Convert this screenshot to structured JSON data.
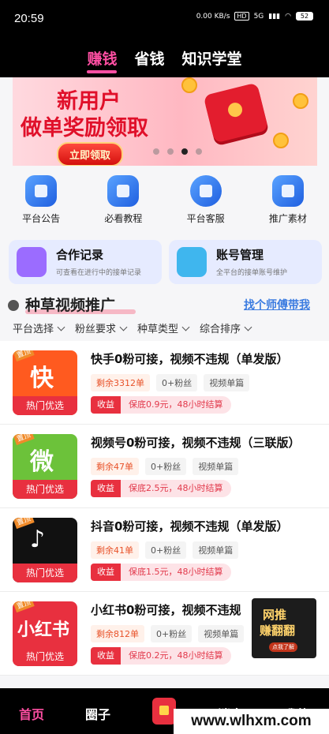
{
  "status_bar": {
    "time": "20:59",
    "speed": "0.00 KB/s",
    "hd": "HD",
    "network": "5G",
    "battery": "52"
  },
  "top_tabs": [
    "赚钱",
    "省钱",
    "知识学堂"
  ],
  "banner": {
    "line1": "新用户",
    "line2": "做单奖励领取",
    "cta": "立即领取"
  },
  "quick_links": [
    {
      "label": "平台公告",
      "icon": "announcement-icon"
    },
    {
      "label": "必看教程",
      "icon": "tutorial-icon"
    },
    {
      "label": "平台客服",
      "icon": "customer-service-icon"
    },
    {
      "label": "推广素材",
      "icon": "promo-material-icon"
    }
  ],
  "feature_cards": [
    {
      "title": "合作记录",
      "subtitle": "可查看在进行中的接单记录",
      "color": "#9b6cff"
    },
    {
      "title": "账号管理",
      "subtitle": "全平台的接单账号维护",
      "color": "#3fb6ee"
    }
  ],
  "section": {
    "title": "种草视频推广",
    "link": "找个师傅带我"
  },
  "filters": [
    "平台选择",
    "粉丝要求",
    "种草类型",
    "综合排序"
  ],
  "tasks": [
    {
      "title": "快手0粉可接，视频不违规（单发版）",
      "remaining": "剩余3312单",
      "fans": "0+粉丝",
      "type": "视频单篇",
      "income_label": "收益",
      "income_value": "保底0.9元，48小时结算",
      "hot": "热门优选",
      "top_tag": "置顶",
      "logo": "快",
      "color": "#ff5a1f"
    },
    {
      "title": "视频号0粉可接，视频不违规（三联版）",
      "remaining": "剩余47单",
      "fans": "0+粉丝",
      "type": "视频单篇",
      "income_label": "收益",
      "income_value": "保底2.5元，48小时结算",
      "hot": "热门优选",
      "top_tag": "置顶",
      "logo": "微",
      "color": "#6cc23a"
    },
    {
      "title": "抖音0粉可接，视频不违规（单发版）",
      "remaining": "剩余41单",
      "fans": "0+粉丝",
      "type": "视频单篇",
      "income_label": "收益",
      "income_value": "保底1.5元，48小时结算",
      "hot": "热门优选",
      "top_tag": "置顶",
      "logo": "♪",
      "color": "#111111"
    },
    {
      "title": "小红书0粉可接，视频不违规",
      "remaining": "剩余812单",
      "fans": "0+粉丝",
      "type": "视频单篇",
      "income_label": "收益",
      "income_value": "保底0.2元，48小时结算",
      "hot": "热门优选",
      "top_tag": "置顶",
      "logo": "小红书",
      "color": "#e8303f"
    }
  ],
  "float_ad": {
    "line1": "网推",
    "line2": "赚翻翻",
    "line3": "点我了解"
  },
  "bottom_nav": [
    "首页",
    "圈子",
    "消息",
    "我的"
  ],
  "watermark": "www.wlhxm.com"
}
